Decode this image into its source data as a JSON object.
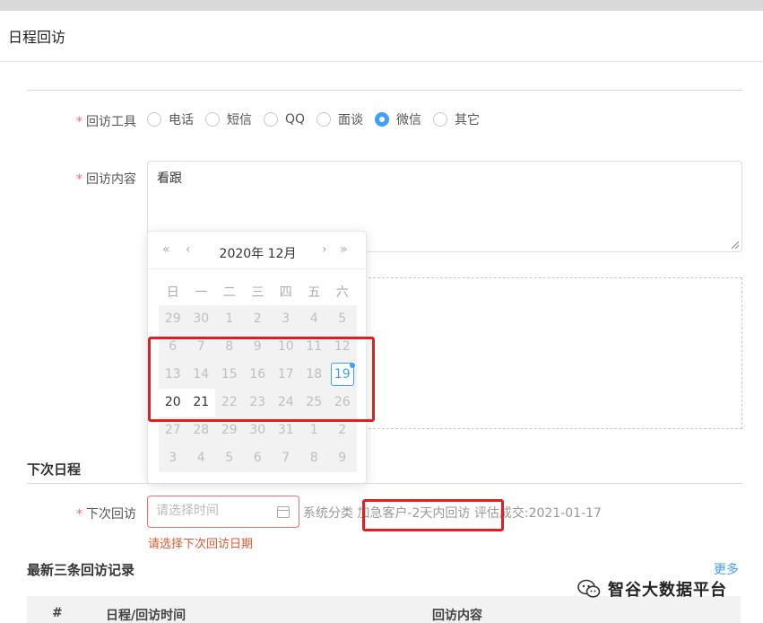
{
  "header": {
    "title": "日程回访"
  },
  "form": {
    "tool": {
      "label": "回访工具",
      "required": "*",
      "options": [
        "电话",
        "短信",
        "QQ",
        "面谈",
        "微信",
        "其它"
      ],
      "selected": "微信"
    },
    "content": {
      "label": "回访内容",
      "required": "*",
      "value": "看跟"
    }
  },
  "calendar": {
    "title": "2020年 12月",
    "nav": {
      "prev_year": "«",
      "prev_month": "‹",
      "next_month": "›",
      "next_year": "»"
    },
    "weekdays": [
      "日",
      "一",
      "二",
      "三",
      "四",
      "五",
      "六"
    ],
    "rows": [
      [
        "29",
        "30",
        "1",
        "2",
        "3",
        "4",
        "5"
      ],
      [
        "6",
        "7",
        "8",
        "9",
        "10",
        "11",
        "12"
      ],
      [
        "13",
        "14",
        "15",
        "16",
        "17",
        "18",
        "19"
      ],
      [
        "20",
        "21",
        "22",
        "23",
        "24",
        "25",
        "26"
      ],
      [
        "27",
        "28",
        "29",
        "30",
        "31",
        "1",
        "2"
      ],
      [
        "3",
        "4",
        "5",
        "6",
        "7",
        "8",
        "9"
      ]
    ],
    "today": "19",
    "enabled_days": [
      "20",
      "21"
    ]
  },
  "next_schedule": {
    "section_title": "下次日程",
    "label": "下次回访",
    "required": "*",
    "placeholder": "请选择时间",
    "system_text": "系统分类 加急客户-2天内回访 评估成交:2021-01-17",
    "error": "请选择下次回访日期"
  },
  "records": {
    "title": "最新三条回访记录",
    "more": "更多",
    "columns": [
      "#",
      "日程/回访时间",
      "回访内容"
    ]
  },
  "watermark": {
    "text": "智谷大数据平台"
  },
  "colors": {
    "accent": "#409eff",
    "required": "#f56c6c",
    "highlight_box": "#e02020"
  }
}
